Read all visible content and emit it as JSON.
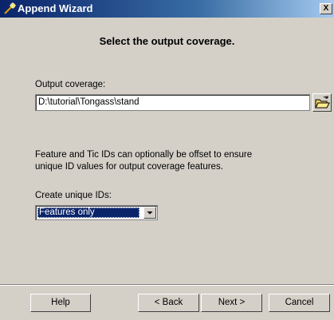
{
  "window": {
    "title": "Append Wizard",
    "close_label": "X"
  },
  "heading": "Select the output coverage.",
  "output_coverage": {
    "label": "Output coverage:",
    "value": "D:\\tutorial\\Tongass\\stand"
  },
  "note": {
    "line1": "Feature and Tic IDs can optionally be offset to ensure",
    "line2": "unique ID values for output coverage features."
  },
  "unique_ids": {
    "label": "Create unique IDs:",
    "selected": "Features only"
  },
  "buttons": {
    "help": "Help",
    "back": "< Back",
    "next": "Next >",
    "cancel": "Cancel"
  },
  "icons": {
    "title_icon": "arcgis-wand-icon",
    "browse_icon": "open-folder-icon",
    "dropdown_icon": "chevron-down-icon"
  }
}
